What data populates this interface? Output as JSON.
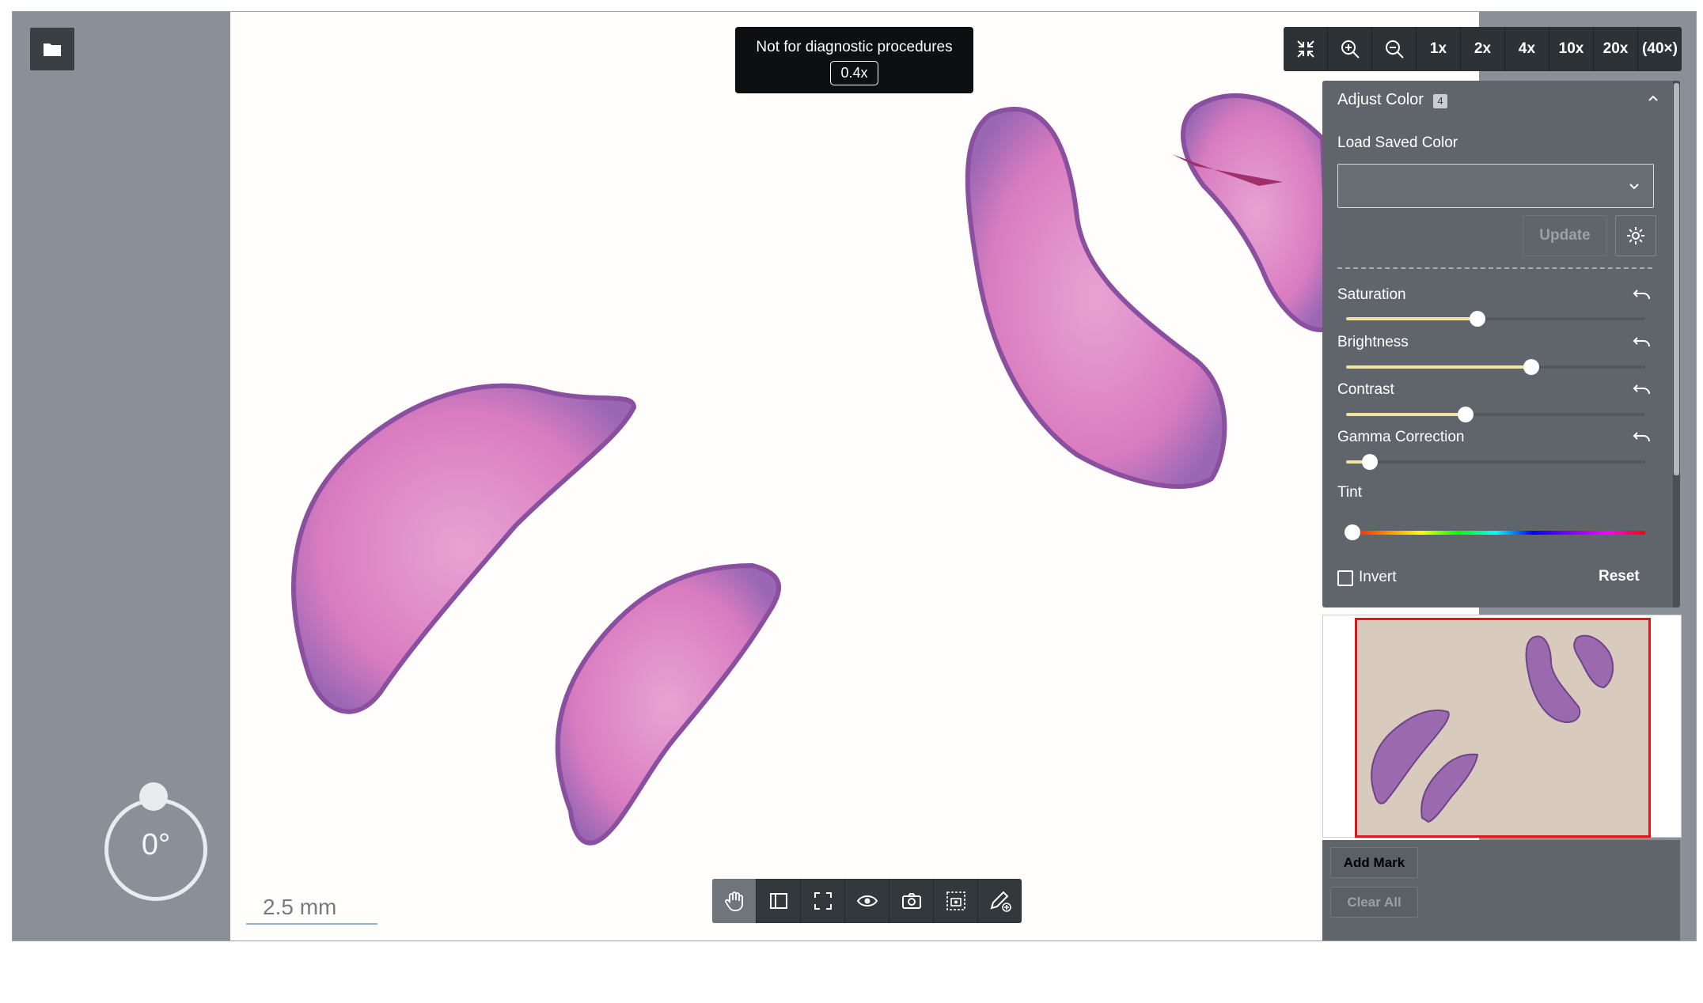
{
  "viewer": {
    "notice_text": "Not for diagnostic procedures",
    "current_zoom": "0.4x",
    "scale_bar": "2.5 mm",
    "rotation": "0°"
  },
  "zoom_toolbar": {
    "icons": [
      "fit-screen-icon",
      "zoom-in-icon",
      "zoom-out-icon"
    ],
    "levels": [
      "1x",
      "2x",
      "4x",
      "10x",
      "20x",
      "(40×)"
    ]
  },
  "bottom_toolbar": {
    "tools": [
      "hand-icon",
      "sidebar-icon",
      "fullscreen-icon",
      "eye-icon",
      "camera-icon",
      "region-capture-icon",
      "annotate-icon"
    ],
    "active": "hand-icon"
  },
  "adjust_color": {
    "title": "Adjust Color",
    "badge": "4",
    "load_saved_label": "Load Saved Color",
    "dropdown_value": "",
    "update_label": "Update",
    "sliders": [
      {
        "label": "Saturation",
        "value": 0.44
      },
      {
        "label": "Brightness",
        "value": 0.62
      },
      {
        "label": "Contrast",
        "value": 0.4
      },
      {
        "label": "Gamma Correction",
        "value": 0.08
      }
    ],
    "tint_label": "Tint",
    "tint_value": 0.02,
    "invert_label": "Invert",
    "invert_checked": false,
    "reset_label": "Reset"
  },
  "marks": {
    "add_label": "Add Mark",
    "clear_label": "Clear All"
  },
  "colors": {
    "panel_bg": "#5f656b",
    "toolbar_bg": "#2d3237",
    "slider_fill": "#f1e3a0",
    "minimap_frame": "#e0181d",
    "tissue_pink": "#de7fc0",
    "tissue_purple": "#8a5ba8"
  }
}
